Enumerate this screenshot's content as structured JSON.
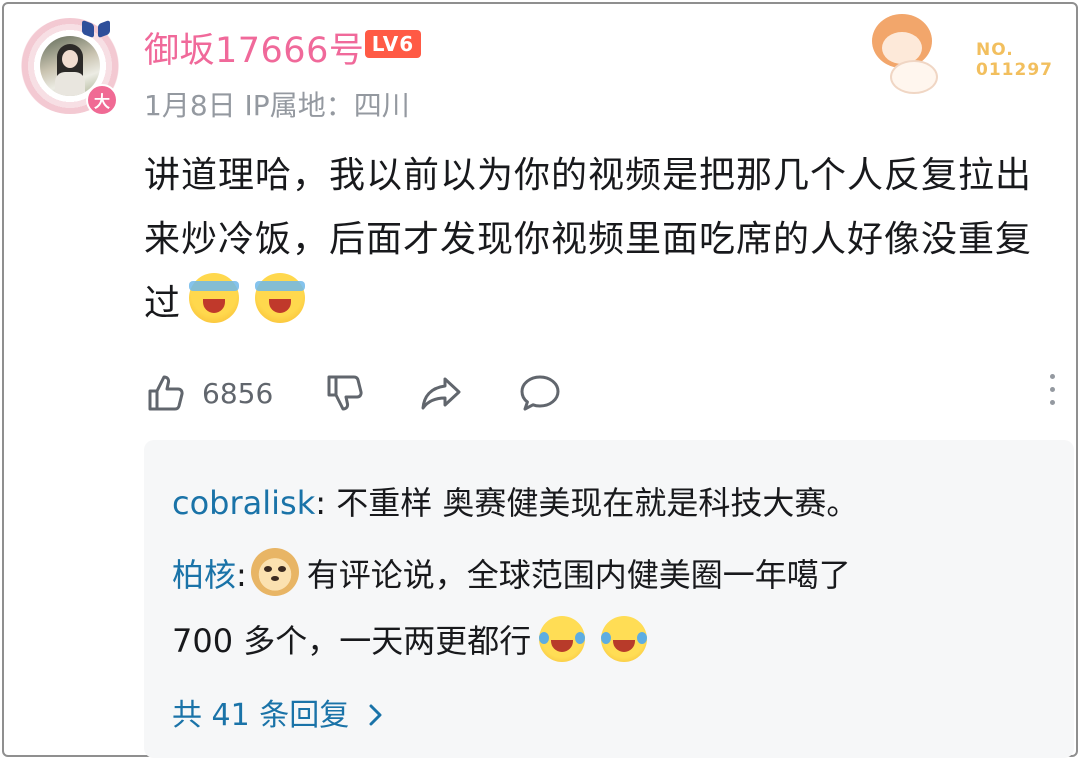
{
  "comment": {
    "username": "御坂17666号",
    "level_badge": "LV6",
    "avatar_badge": "大",
    "date": "1月8日",
    "ip_location": "IP属地：四川",
    "decoration_number_label": "NO.",
    "decoration_number": "011297",
    "content": "讲道理哈，我以前以为你的视频是把那几个人反复拉出来炒冷饭，后面才发现你视频里面吃席的人好像没重复过",
    "like_count": "6856"
  },
  "icons": [
    "like-icon",
    "dislike-icon",
    "share-icon",
    "reply-icon",
    "more-icon",
    "chevron-right-icon"
  ],
  "replies": [
    {
      "name": "cobralisk",
      "separator": ":",
      "text": "不重样 奥赛健美现在就是科技大赛。"
    },
    {
      "name": "柏核",
      "separator": ":",
      "text_line1": "有评论说，全球范围内健美圈一年噶了",
      "text_line2": "700 多个，一天两更都行"
    }
  ],
  "more_replies": "共 41 条回复"
}
